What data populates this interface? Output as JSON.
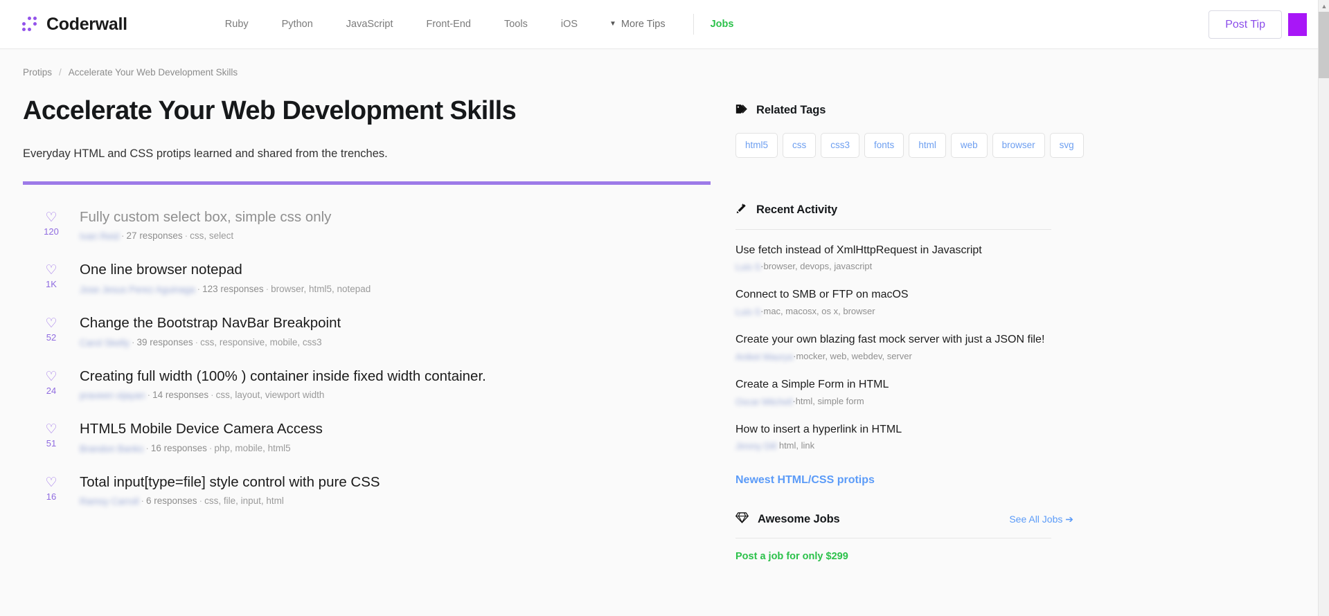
{
  "header": {
    "brand": "Coderwall",
    "logo_icon": "dot-grid-logo-icon",
    "nav": [
      {
        "label": "Ruby"
      },
      {
        "label": "Python"
      },
      {
        "label": "JavaScript"
      },
      {
        "label": "Front-End"
      },
      {
        "label": "Tools"
      },
      {
        "label": "iOS"
      }
    ],
    "more_tips": "More Tips",
    "more_tips_icon": "caret-down-icon",
    "jobs": "Jobs",
    "post_tip": "Post Tip",
    "avatar_color": "#a817f7",
    "jobs_color": "#2bc14a",
    "accent_color": "#8b4dea"
  },
  "breadcrumb": {
    "root": "Protips",
    "separator": "/",
    "current": "Accelerate Your Web Development Skills"
  },
  "main": {
    "title": "Accelerate Your Web Development Skills",
    "subtitle": "Everyday HTML and CSS protips learned and shared from the trenches.",
    "rule_color": "#9d7ae8",
    "tips": [
      {
        "votes": "120",
        "heart_icon": "heart-outline-icon",
        "title": "Fully custom select box, simple css only",
        "visited": true,
        "author": "Ivan Reid",
        "responses": "27 responses",
        "tags": "css, select"
      },
      {
        "votes": "1K",
        "heart_icon": "heart-outline-icon",
        "title": "One line browser notepad",
        "visited": false,
        "author": "Jose Jesus Perez Aguinaga",
        "responses": "123 responses",
        "tags": "browser, html5, notepad"
      },
      {
        "votes": "52",
        "heart_icon": "heart-outline-icon",
        "title": "Change the Bootstrap NavBar Breakpoint",
        "visited": false,
        "author": "Carol Skelly",
        "responses": "39 responses",
        "tags": "css, responsive, mobile, css3"
      },
      {
        "votes": "24",
        "heart_icon": "heart-outline-icon",
        "title": "Creating full width (100% ) container inside fixed width container.",
        "visited": false,
        "author": "praveen vijayan",
        "responses": "14 responses",
        "tags": "css, layout, viewport width"
      },
      {
        "votes": "51",
        "heart_icon": "heart-outline-icon",
        "title": "HTML5 Mobile Device Camera Access",
        "visited": false,
        "author": "Brandon Banks",
        "responses": "16 responses",
        "tags": "php, mobile, html5"
      },
      {
        "votes": "16",
        "heart_icon": "heart-outline-icon",
        "title": "Total input[type=file] style control with pure CSS",
        "visited": false,
        "author": "Ramsy Carroll",
        "responses": "6 responses",
        "tags": "css, file, input, html"
      }
    ]
  },
  "sidebar": {
    "related_tags": {
      "icon": "tag-icon",
      "title": "Related Tags",
      "tags": [
        "html5",
        "css",
        "css3",
        "fonts",
        "html",
        "web",
        "browser",
        "svg"
      ]
    },
    "recent_activity": {
      "icon": "magic-wand-icon",
      "title": "Recent Activity",
      "items": [
        {
          "title": "Use fetch instead of XmlHttpRequest in Javascript",
          "author": "Luis S",
          "tags": "browser, devops, javascript"
        },
        {
          "title": "Connect to SMB or FTP on macOS",
          "author": "Luis S",
          "tags": "mac, macosx, os x, browser"
        },
        {
          "title": "Create your own blazing fast mock server with just a JSON file!",
          "author": "Aniket Maurya",
          "tags": "mocker, web, webdev, server"
        },
        {
          "title": "Create a Simple Form in HTML",
          "author": "Oscar Mitchell",
          "tags": "html, simple form"
        },
        {
          "title": "How to insert a hyperlink in HTML",
          "author": "Jimmy Dill",
          "tags": "html, link"
        }
      ],
      "newest_link": "Newest HTML/CSS protips"
    },
    "awesome_jobs": {
      "icon": "gem-icon",
      "title": "Awesome Jobs",
      "see_all": "See All Jobs ➔",
      "promo": "Post a job for only $299"
    }
  },
  "scrollbar": {
    "up_arrow": "▲",
    "down_arrow": "▼"
  }
}
